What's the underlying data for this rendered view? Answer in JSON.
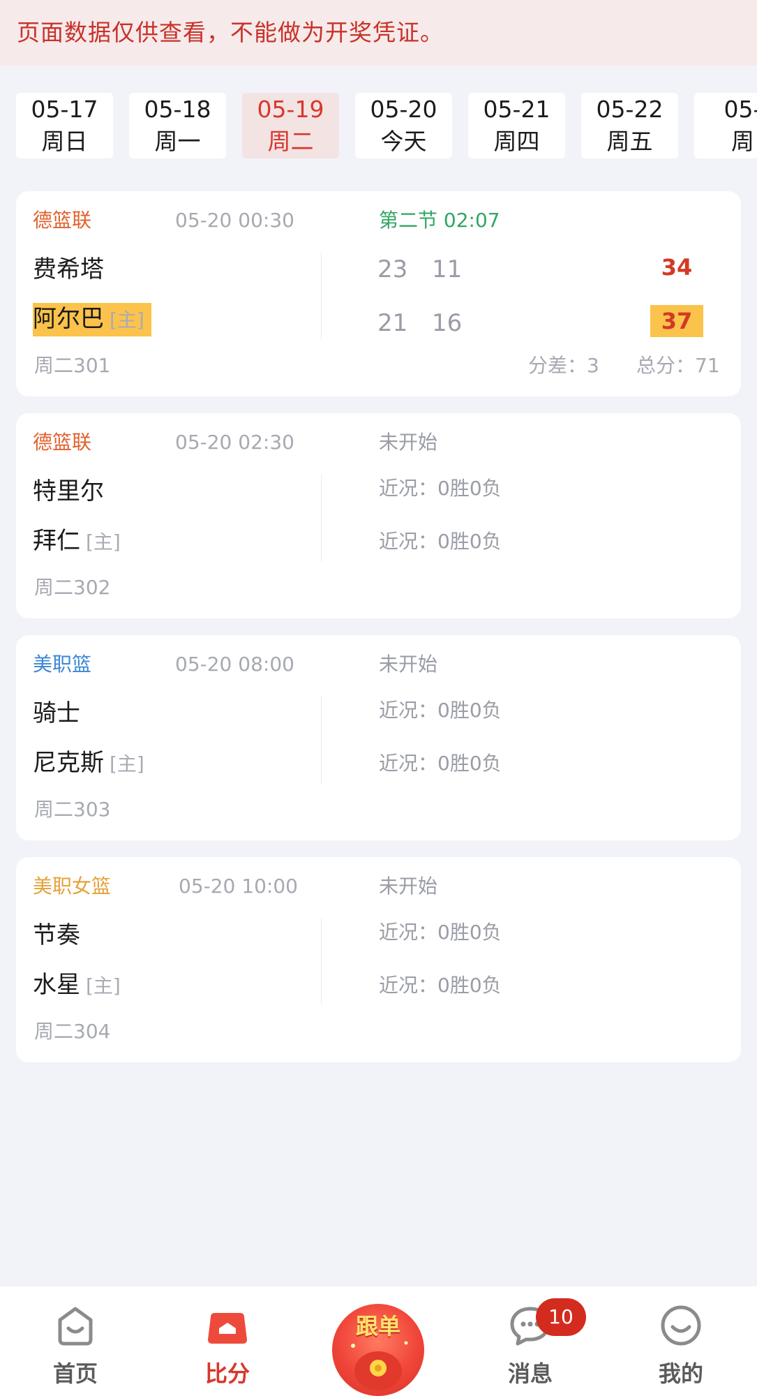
{
  "notice": "页面数据仅供查看，不能做为开奖凭证。",
  "dates": [
    {
      "date": "05-17",
      "day": "周日"
    },
    {
      "date": "05-18",
      "day": "周一"
    },
    {
      "date": "05-19",
      "day": "周二"
    },
    {
      "date": "05-20",
      "day": "今天"
    },
    {
      "date": "05-21",
      "day": "周四"
    },
    {
      "date": "05-22",
      "day": "周五"
    },
    {
      "date": "05-",
      "day": "周"
    }
  ],
  "selected_date_index": 2,
  "home_tag": "[主]",
  "matches": [
    {
      "league": "德篮联",
      "league_color": "#e0612c",
      "time": "05-20 00:30",
      "status": "第二节 02:07",
      "away": "费希塔",
      "home": "阿尔巴",
      "away_quarters": [
        "23",
        "11"
      ],
      "home_quarters": [
        "21",
        "16"
      ],
      "away_total": "34",
      "home_total": "37",
      "code": "周二301",
      "diff": "分差：3",
      "sum": "总分：71"
    },
    {
      "league": "德篮联",
      "league_color": "#e0612c",
      "time": "05-20 02:30",
      "status": "未开始",
      "away": "特里尔",
      "home": "拜仁",
      "away_record": "近况：0胜0负",
      "home_record": "近况：0胜0负",
      "code": "周二302"
    },
    {
      "league": "美职篮",
      "league_color": "#3a86d6",
      "time": "05-20 08:00",
      "status": "未开始",
      "away": "骑士",
      "home": "尼克斯",
      "away_record": "近况：0胜0负",
      "home_record": "近况：0胜0负",
      "code": "周二303"
    },
    {
      "league": "美职女篮",
      "league_color": "#e5a23a",
      "time": "05-20 10:00",
      "status": "未开始",
      "away": "节奏",
      "home": "水星",
      "away_record": "近况：0胜0负",
      "home_record": "近况：0胜0负",
      "code": "周二304"
    }
  ],
  "tabbar": {
    "home": "首页",
    "scores": "比分",
    "follow": "跟单",
    "messages": "消息",
    "messages_badge": "10",
    "mine": "我的"
  },
  "colors": {
    "accent": "#d8372c",
    "highlight": "#fbc34b",
    "live": "#31a663"
  }
}
